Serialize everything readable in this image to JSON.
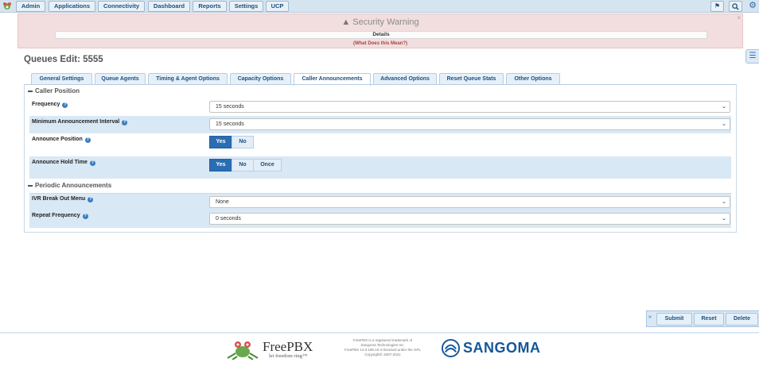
{
  "nav": {
    "items": [
      "Admin",
      "Applications",
      "Connectivity",
      "Dashboard",
      "Reports",
      "Settings",
      "UCP"
    ]
  },
  "warning": {
    "title": "Security Warning",
    "details": "Details",
    "link": "(What Does this Mean?)",
    "close": "×"
  },
  "page": {
    "title": "Queues Edit: 5555"
  },
  "tabs": [
    "General Settings",
    "Queue Agents",
    "Timing & Agent Options",
    "Capacity Options",
    "Caller Announcements",
    "Advanced Options",
    "Reset Queue Stats",
    "Other Options"
  ],
  "active_tab": "Caller Announcements",
  "sections": {
    "caller_position": "Caller Position",
    "periodic": "Periodic Announcements"
  },
  "fields": {
    "frequency": {
      "label": "Frequency",
      "value": "15 seconds"
    },
    "min_interval": {
      "label": "Minimum Announcement Interval",
      "value": "15 seconds"
    },
    "announce_position": {
      "label": "Announce Position",
      "options": [
        "Yes",
        "No"
      ],
      "selected": "Yes"
    },
    "announce_hold": {
      "label": "Announce Hold Time",
      "options": [
        "Yes",
        "No",
        "Once"
      ],
      "selected": "Yes"
    },
    "ivr_break": {
      "label": "IVR Break Out Menu",
      "value": "None"
    },
    "repeat_freq": {
      "label": "Repeat Frequency",
      "value": "0 seconds"
    }
  },
  "help_glyph": "?",
  "actions": {
    "arrow": "»",
    "submit": "Submit",
    "reset": "Reset",
    "delete": "Delete"
  },
  "footer": {
    "freepbx": "FreePBX",
    "tagline": "let freedom ring™",
    "legal": [
      "FreePBX is a registered trademark of",
      "Sangoma Technologies Inc.",
      "FreePBX 13.0.190.16 is licensed under the GPL",
      "Copyright© 2007-2021"
    ],
    "sangoma": "SANGOMA"
  },
  "colors": {
    "accent": "#2a6db3",
    "warning_bg": "#f2dede",
    "row_highlight": "#d9e8f5",
    "brand_sangoma": "#13569a"
  },
  "icons": [
    "freepbx-frog-icon",
    "flag-icon",
    "search-icon",
    "gear-icon",
    "warning-triangle-icon",
    "list-toggle-icon",
    "help-icon",
    "sangoma-logo-icon"
  ]
}
